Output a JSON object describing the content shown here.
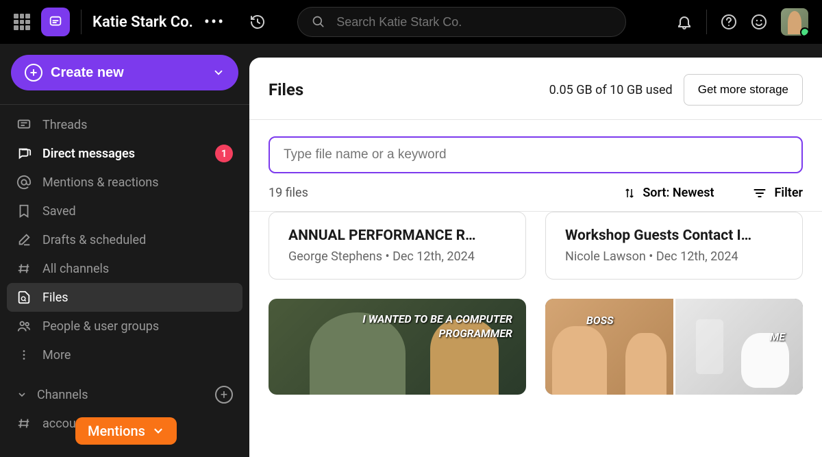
{
  "header": {
    "workspace_name": "Katie Stark Co.",
    "search_placeholder": "Search Katie Stark Co."
  },
  "sidebar": {
    "create_button": "Create new",
    "items": [
      {
        "label": "Threads",
        "icon": "chat"
      },
      {
        "label": "Direct messages",
        "icon": "dm",
        "bold": true,
        "badge": "1"
      },
      {
        "label": "Mentions & reactions",
        "icon": "at"
      },
      {
        "label": "Saved",
        "icon": "bookmark"
      },
      {
        "label": "Drafts & scheduled",
        "icon": "draft"
      },
      {
        "label": "All channels",
        "icon": "channels"
      },
      {
        "label": "Files",
        "icon": "files",
        "active": true
      },
      {
        "label": "People & user groups",
        "icon": "people"
      },
      {
        "label": "More",
        "icon": "more"
      }
    ],
    "channels_header": "Channels",
    "channel_items": [
      {
        "label": "accounting-team"
      }
    ],
    "mentions_tag": "Mentions"
  },
  "content": {
    "title": "Files",
    "storage_text": "0.05 GB of 10 GB used",
    "storage_button": "Get more storage",
    "search_placeholder": "Type file name or a keyword",
    "file_count": "19 files",
    "sort_label": "Sort: Newest",
    "filter_label": "Filter",
    "files": [
      {
        "title": "ANNUAL PERFORMANCE R…",
        "author": "George Stephens",
        "date": "Dec 12th, 2024"
      },
      {
        "title": "Workshop Guests Contact I…",
        "author": "Nicole Lawson",
        "date": "Dec 12th, 2024"
      }
    ],
    "image1_text": "I WANTED TO BE A COMPUTER\nPROGRAMMER",
    "image2_label_left": "BOSS",
    "image2_label_right": "ME"
  }
}
